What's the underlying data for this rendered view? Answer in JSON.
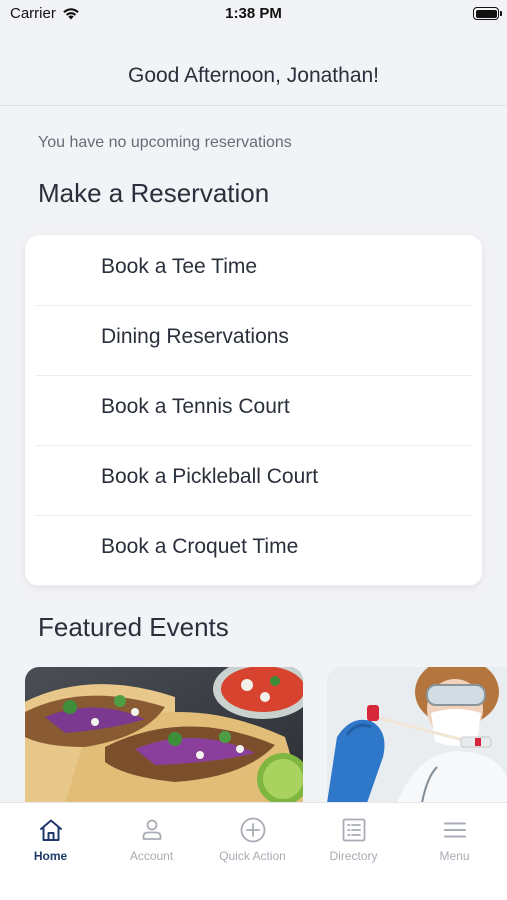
{
  "status_bar": {
    "carrier": "Carrier",
    "time": "1:38 PM"
  },
  "header": {
    "greeting": "Good Afternoon, Jonathan!"
  },
  "reservations": {
    "empty_message": "You have no upcoming reservations"
  },
  "make_reservation": {
    "title": "Make a Reservation",
    "items": [
      {
        "label": "Book a Tee Time"
      },
      {
        "label": "Dining Reservations"
      },
      {
        "label": "Book a Tennis Court"
      },
      {
        "label": "Book a Pickleball Court"
      },
      {
        "label": "Book a Croquet Time"
      }
    ]
  },
  "featured_events": {
    "title": "Featured Events"
  },
  "tab_bar": {
    "active_color": "#1f3a6b",
    "inactive_color": "#a7acb5",
    "tabs": [
      {
        "label": "Home",
        "icon": "home-icon",
        "active": true
      },
      {
        "label": "Account",
        "icon": "person-icon",
        "active": false
      },
      {
        "label": "Quick Action",
        "icon": "plus-circle-icon",
        "active": false
      },
      {
        "label": "Directory",
        "icon": "list-icon",
        "active": false
      },
      {
        "label": "Menu",
        "icon": "hamburger-icon",
        "active": false
      }
    ]
  }
}
